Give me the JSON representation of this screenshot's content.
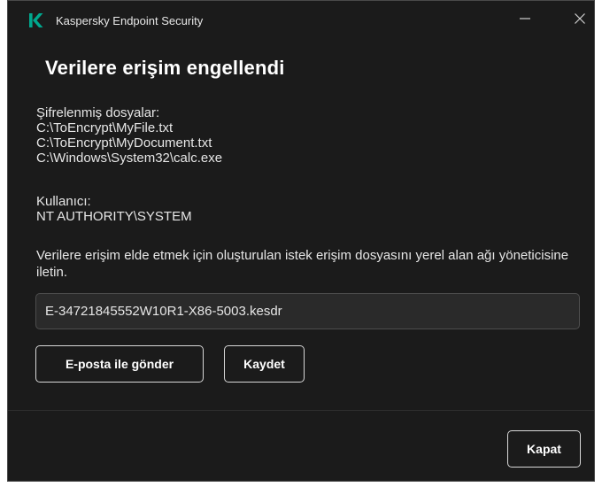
{
  "window": {
    "title": "Kaspersky Endpoint Security",
    "brand_color": "#00a88e"
  },
  "titlebar": {
    "minimize_icon": "minimize-icon",
    "close_icon": "close-icon"
  },
  "dialog": {
    "heading": "Verilere erişim engellendi",
    "files_label": "Şifrelenmiş dosyalar:",
    "files": [
      "C:\\ToEncrypt\\MyFile.txt",
      "C:\\ToEncrypt\\MyDocument.txt",
      "C:\\Windows\\System32\\calc.exe"
    ],
    "user_label": "Kullanıcı:",
    "user_value": "NT AUTHORITY\\SYSTEM",
    "instruction": "Verilere erişim elde etmek için oluşturulan istek erişim dosyasını yerel alan ağı yöneticisine iletin.",
    "request_file": "E-34721845552W10R1-X86-5003.kesdr",
    "email_button": "E-posta ile gönder",
    "save_button": "Kaydet"
  },
  "footer": {
    "close_button": "Kapat"
  }
}
